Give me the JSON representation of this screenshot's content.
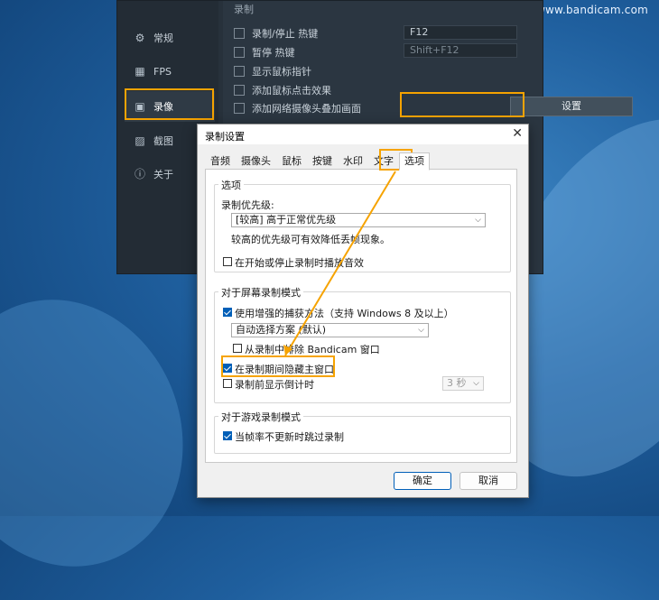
{
  "watermark": "www.bandicam.com",
  "main_window": {
    "sidebar": [
      {
        "label": "常规",
        "icon": "gear-icon"
      },
      {
        "label": "FPS",
        "icon": "fps-icon"
      },
      {
        "label": "录像",
        "icon": "video-icon"
      },
      {
        "label": "截图",
        "icon": "image-icon"
      },
      {
        "label": "关于",
        "icon": "info-icon"
      }
    ],
    "section_title": "录制",
    "rows": [
      {
        "label": "录制/停止 热键",
        "key": "F12"
      },
      {
        "label": "暂停 热键",
        "key": "Shift+F12"
      },
      {
        "label": "显示鼠标指针"
      },
      {
        "label": "添加鼠标点击效果"
      },
      {
        "label": "添加网络摄像头叠加画面"
      }
    ],
    "settings_button": "设置"
  },
  "dialog": {
    "title": "录制设置",
    "tabs": [
      "音频",
      "摄像头",
      "鼠标",
      "按键",
      "水印",
      "文字",
      "选项"
    ],
    "active_tab": "选项",
    "group_options": {
      "title": "选项",
      "priority_label": "录制优先级:",
      "priority_value": "[较高] 高于正常优先级",
      "priority_hint": "较高的优先级可有效降低丢帧现象。",
      "play_sound_label": "在开始或停止录制时播放音效",
      "play_sound_checked": false
    },
    "group_screen": {
      "title": "对于屏幕录制模式",
      "enhanced_capture_label": "使用增强的捕获方法（支持 Windows 8 及以上）",
      "enhanced_capture_checked": true,
      "capture_method_value": "自动选择方案 (默认)",
      "exclude_window_label": "从录制中排除 Bandicam 窗口",
      "exclude_window_checked": false,
      "hide_main_label": "在录制期间隐藏主窗口",
      "hide_main_checked": true,
      "countdown_label": "录制前显示倒计时",
      "countdown_checked": false,
      "countdown_value": "3 秒"
    },
    "group_game": {
      "title": "对于游戏录制模式",
      "skip_label": "当帧率不更新时跳过录制",
      "skip_checked": true
    },
    "ok_button": "确定",
    "cancel_button": "取消"
  },
  "accent_color": "#f6a300"
}
